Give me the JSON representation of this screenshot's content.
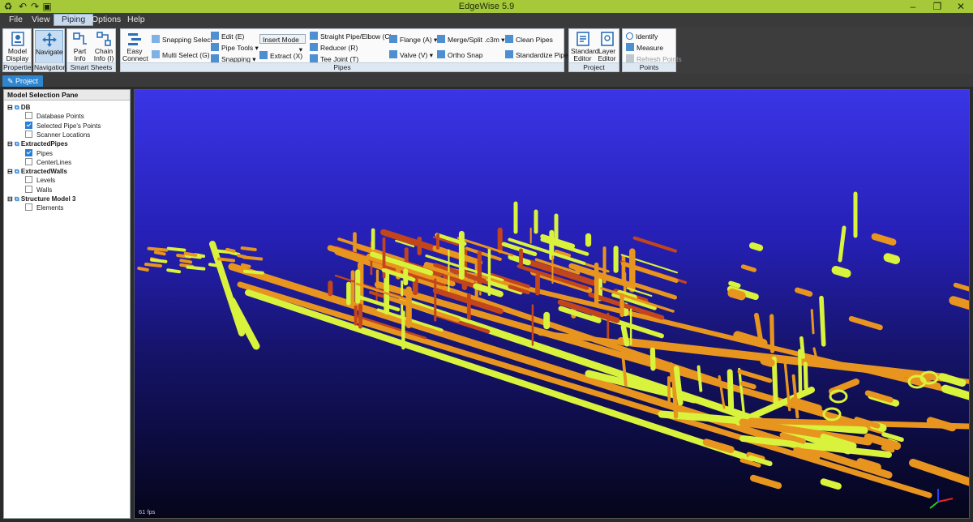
{
  "app": {
    "title": "EdgeWise 5.9"
  },
  "menu": {
    "items": [
      "File",
      "View",
      "Piping",
      "Options",
      "Help"
    ],
    "active": "Piping"
  },
  "ribbon": {
    "properties": {
      "model_display": "Model\nDisplay",
      "label": "Properties"
    },
    "navigation": {
      "navigate": "Navigate",
      "label": "Navigation"
    },
    "smart_sheets": {
      "part_info": "Part\nInfo (Q)",
      "chain_info": "Chain\nInfo (I)",
      "label": "Smart Sheets"
    },
    "pipes": {
      "easy_connect": "Easy\nConnect",
      "snapping_select": "Snapping Select",
      "multi_select": "Multi Select (G)",
      "edit": "Edit (E)",
      "pipe_tools": "Pipe Tools",
      "snapping": "Snapping",
      "insert_mode": "Insert Mode",
      "extract": "Extract (X)",
      "straight_pipe": "Straight Pipe/Elbow (C)",
      "reducer": "Reducer (R)",
      "tee_joint": "Tee Joint (T)",
      "flange": "Flange (A)",
      "valve": "Valve (V)",
      "merge_split": "Merge/Split .c3m",
      "ortho_snap": "Ortho Snap",
      "clean_pipes": "Clean Pipes",
      "standardize_pipes": "Standardize Pipes",
      "label": "Pipes"
    },
    "project": {
      "standard_editor": "Standard\nEditor",
      "layer_editor": "Layer\nEditor",
      "label": "Project"
    },
    "points": {
      "identify": "Identify",
      "measure": "Measure",
      "refresh_points": "Refresh Points",
      "label": "Points"
    }
  },
  "tabs": {
    "project": "Project"
  },
  "pane": {
    "title": "Model Selection Pane",
    "groups": [
      {
        "name": "DB",
        "children": [
          {
            "label": "Database Points",
            "checked": false
          },
          {
            "label": "Selected Pipe's Points",
            "checked": true
          },
          {
            "label": "Scanner Locations",
            "checked": false
          }
        ]
      },
      {
        "name": "ExtractedPipes",
        "children": [
          {
            "label": "Pipes",
            "checked": true
          },
          {
            "label": "CenterLines",
            "checked": false
          }
        ]
      },
      {
        "name": "ExtractedWalls",
        "children": [
          {
            "label": "Levels",
            "checked": false
          },
          {
            "label": "Walls",
            "checked": false
          }
        ]
      },
      {
        "name": "Structure Model 3",
        "children": [
          {
            "label": "Elements",
            "checked": false
          }
        ]
      }
    ]
  },
  "viewport": {
    "fps": "61 fps"
  },
  "colors": {
    "accent": "#a6c93a",
    "pipe_orange": "#e8951f",
    "pipe_yellow": "#d9f23c",
    "pipe_red": "#c2451c"
  }
}
